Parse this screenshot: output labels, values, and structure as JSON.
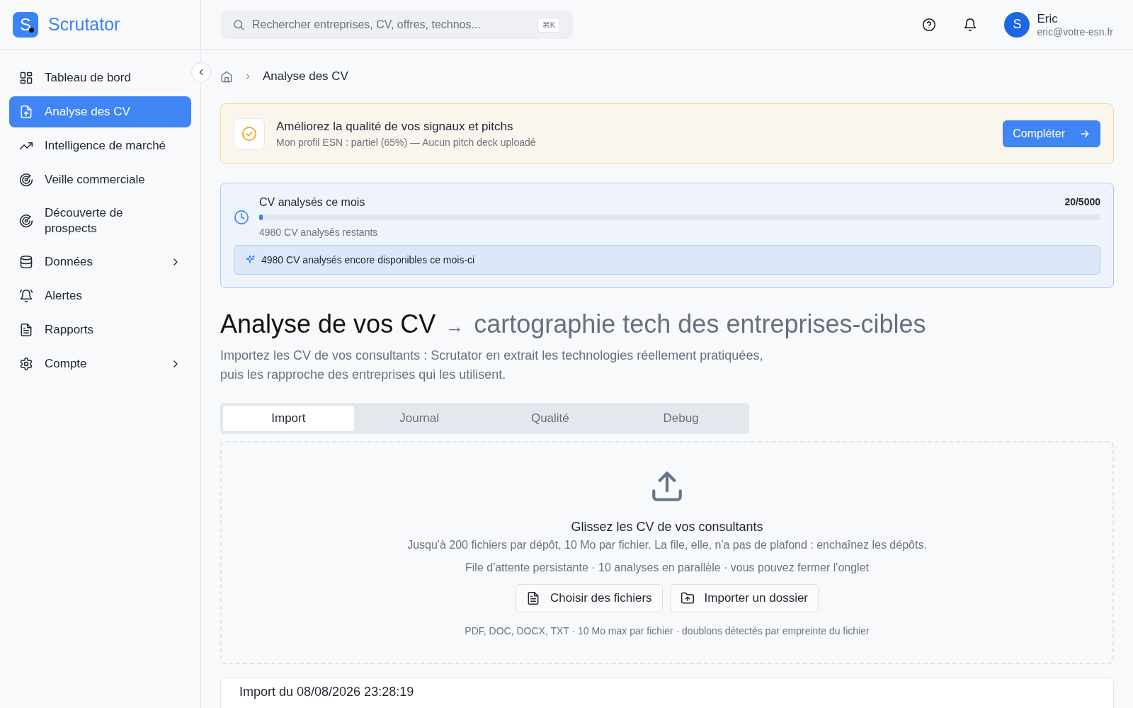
{
  "brand": {
    "logo_letter": "S",
    "name": "Scrutator"
  },
  "search": {
    "placeholder": "Rechercher entreprises, CV, offres, technos...",
    "shortcut": "⌘K"
  },
  "user": {
    "avatar_letter": "S",
    "name": "Eric",
    "email": "eric@votre-esn.fr"
  },
  "sidebar": {
    "items": [
      {
        "label": "Tableau de bord",
        "kind": "grid",
        "selected": false,
        "has_submenu": false
      },
      {
        "label": "Analyse des CV",
        "kind": "upload",
        "selected": true,
        "has_submenu": false
      },
      {
        "label": "Intelligence de marché",
        "kind": "trend",
        "selected": false,
        "has_submenu": false
      },
      {
        "label": "Veille commerciale",
        "kind": "radar",
        "selected": false,
        "has_submenu": false
      },
      {
        "label": "Découverte de prospects",
        "kind": "radar",
        "selected": false,
        "has_submenu": false
      },
      {
        "label": "Données",
        "kind": "database",
        "selected": false,
        "has_submenu": true
      },
      {
        "label": "Alertes",
        "kind": "alarm",
        "selected": false,
        "has_submenu": false
      },
      {
        "label": "Rapports",
        "kind": "report",
        "selected": false,
        "has_submenu": false
      },
      {
        "label": "Compte",
        "kind": "settings",
        "selected": false,
        "has_submenu": true
      }
    ]
  },
  "breadcrumb": [
    "Analyse des CV"
  ],
  "notice": {
    "title": "Améliorez la qualité de vos signaux et pitchs",
    "detail": "Mon profil ESN : partiel (65%) — Aucun pitch deck uploadé",
    "button": "Compléter"
  },
  "quota": {
    "title": "CV analysés ce mois",
    "count": "20/5000",
    "level": 0.004,
    "remaining": "4980 CV analysés restants",
    "info": "4980 CV analysés encore disponibles ce mois-ci"
  },
  "heading": {
    "main": "Analyse de vos CV",
    "arrow": "→",
    "sub": "cartographie tech des entreprises-cibles"
  },
  "description": "Importez les CV de vos consultants : Scrutator en extrait les technologies réellement pratiquées, puis les rapproche des entreprises qui les utilisent.",
  "tabs": [
    {
      "label": "Import",
      "selected": true
    },
    {
      "label": "Journal",
      "selected": false
    },
    {
      "label": "Qualité",
      "selected": false
    },
    {
      "label": "Debug",
      "selected": false
    }
  ],
  "dropzone": {
    "title": "Glissez les CV de vos consultants",
    "line_1": "Jusqu'à 200 fichiers par dépôt, 10 Mo par fichier. La file, elle, n'a pas de plafond : enchaînez les dépôts.",
    "line_2": "File d'attente persistante · 10 analyses en parallèle · vous pouvez fermer l'onglet",
    "buttons": [
      {
        "label": "Choisir des fichiers",
        "kind": "report"
      },
      {
        "label": "Importer un dossier",
        "kind": "folder"
      }
    ],
    "formats": "PDF, DOC, DOCX, TXT · 10 Mo max par fichier · doublons détectés par empreinte du fichier"
  },
  "import_card": {
    "title": "Import du 08/08/2026 23:28:19"
  }
}
